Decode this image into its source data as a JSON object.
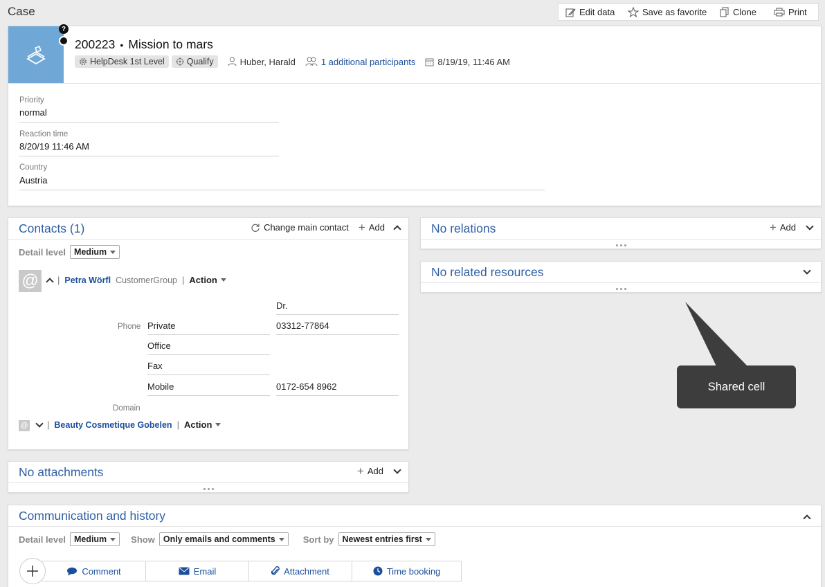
{
  "page": {
    "title": "Case"
  },
  "toolbar": {
    "edit_label": "Edit data",
    "favorite_label": "Save as favorite",
    "clone_label": "Clone",
    "print_label": "Print"
  },
  "header": {
    "number": "200223",
    "separator": "•",
    "title": "Mission to mars",
    "team": "HelpDesk 1st Level",
    "status": "Qualify",
    "owner": "Huber, Harald",
    "participants": "1 additional participants",
    "date": "8/19/19, 11:46 AM",
    "help_glyph": "?"
  },
  "fields": [
    {
      "label": "Priority",
      "value": "normal"
    },
    {
      "label": "Reaction time",
      "value": "8/20/19 11:46 AM"
    },
    {
      "label": "Country",
      "value": "Austria"
    }
  ],
  "contacts": {
    "title": "Contacts (1)",
    "change_label": "Change main contact",
    "add_label": "Add",
    "detail_label": "Detail level",
    "detail_value": "Medium",
    "main_contact": {
      "name": "Petra Wörfl",
      "group": "CustomerGroup",
      "action": "Action",
      "salutation": "Dr."
    },
    "phone_label": "Phone",
    "phones": [
      {
        "type": "Private",
        "number": "03312-77864"
      },
      {
        "type": "Office",
        "number": ""
      },
      {
        "type": "Fax",
        "number": ""
      },
      {
        "type": "Mobile",
        "number": "0172-654 8962"
      }
    ],
    "domain_label": "Domain",
    "company": {
      "name": "Beauty Cosmetique Gobelen",
      "action": "Action"
    },
    "pipe": "|"
  },
  "relations": {
    "title": "No relations",
    "add_label": "Add"
  },
  "resources": {
    "title": "No related resources"
  },
  "attachments": {
    "title": "No attachments",
    "add_label": "Add"
  },
  "tooltip": {
    "text": "Shared cell"
  },
  "history": {
    "title": "Communication and history",
    "detail_label": "Detail level",
    "detail_value": "Medium",
    "show_label": "Show",
    "show_value": "Only emails and comments",
    "sort_label": "Sort by",
    "sort_value": "Newest entries first",
    "actions": [
      "Comment",
      "Email",
      "Attachment",
      "Time booking"
    ]
  },
  "colors": {
    "accent": "#2f5fa5",
    "header_tile": "#6fa8d6",
    "tooltip_bg": "#3d3d3d"
  }
}
